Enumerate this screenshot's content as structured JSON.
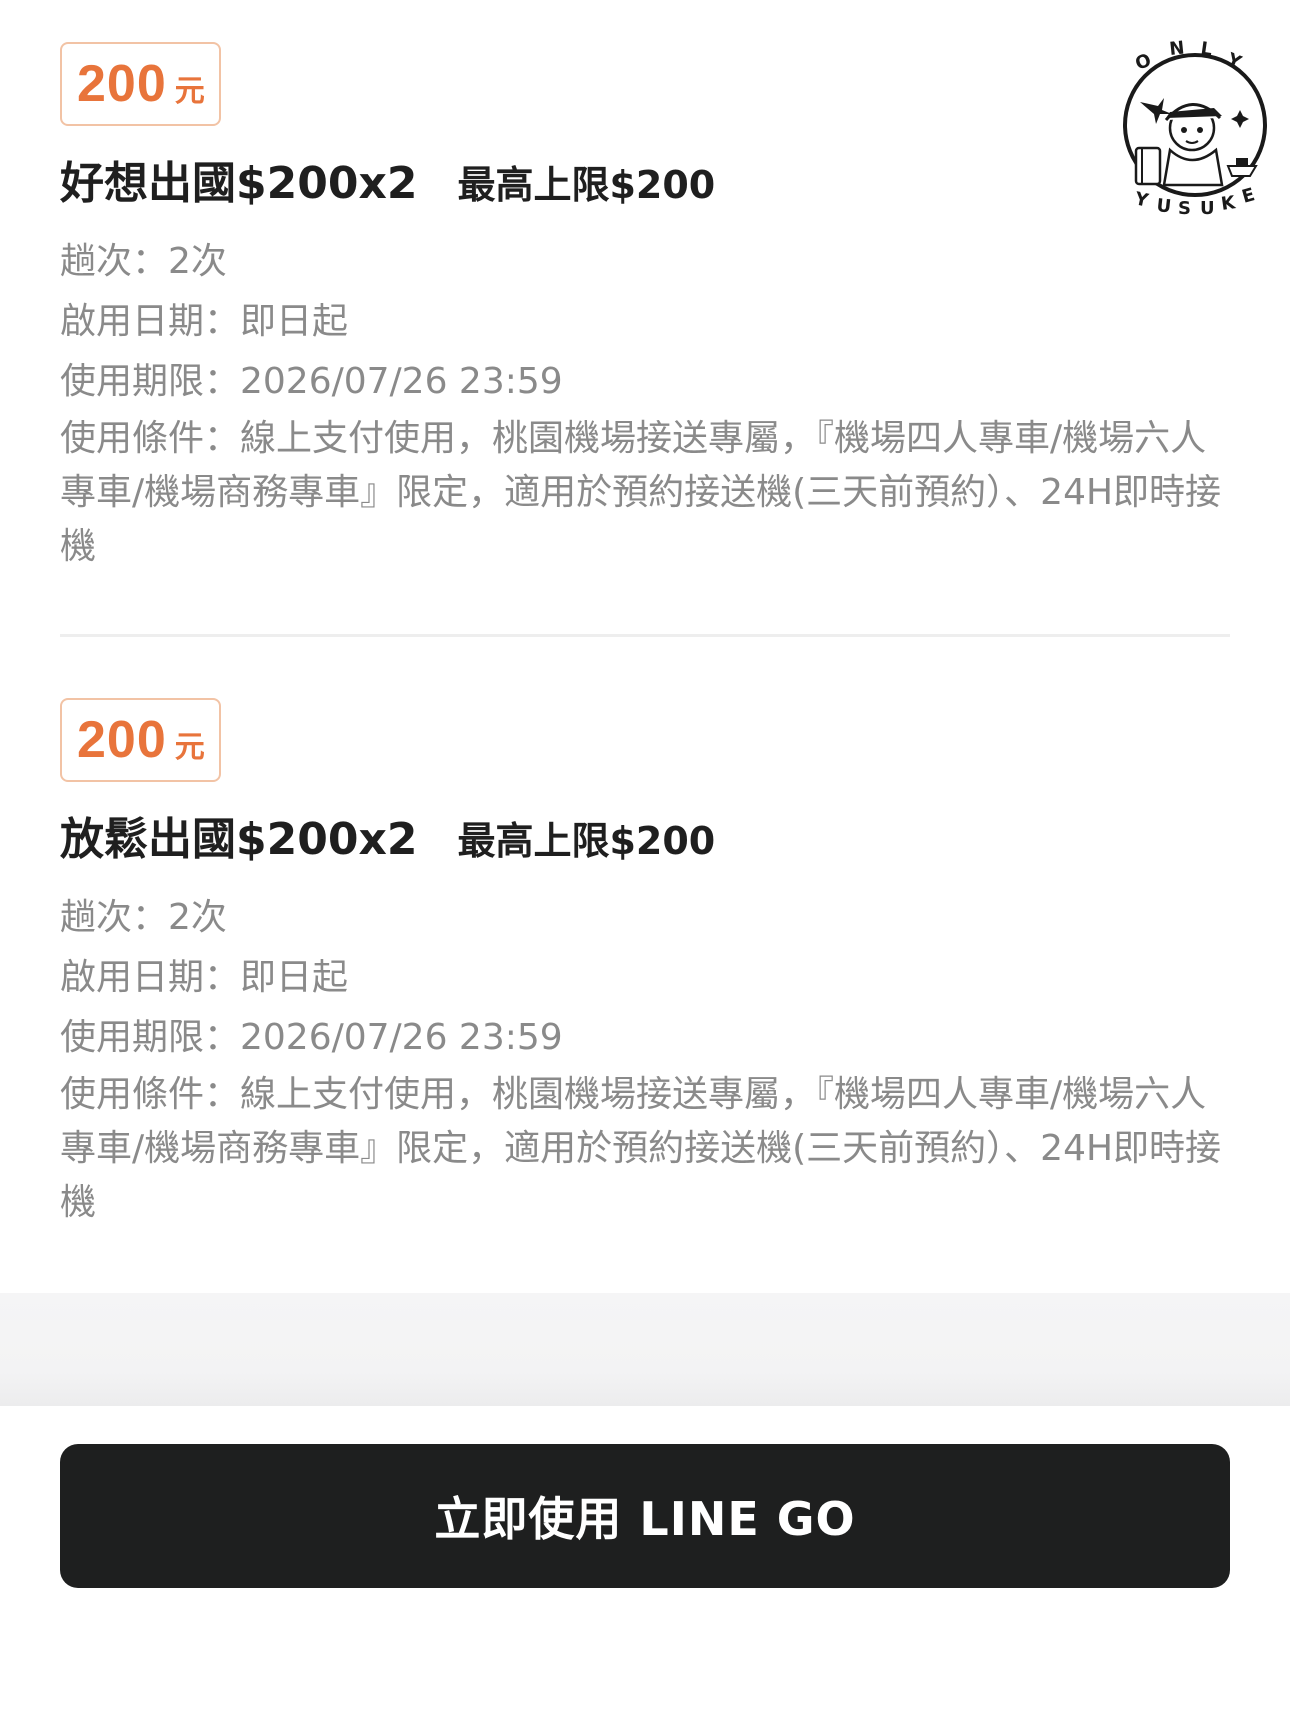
{
  "coupons": [
    {
      "amount": "200",
      "unit": "元",
      "title": "好想出國$200x2",
      "limit": "最高上限$200",
      "trips": "趟次：2次",
      "start_date": "啟用日期：即日起",
      "expiry": "使用期限：2026/07/26 23:59",
      "conditions": "使用條件：線上支付使用，桃園機場接送專屬，『機場四人專車/機場六人專車/機場商務專車』限定，適用於預約接送機(三天前預約）、24H即時接機"
    },
    {
      "amount": "200",
      "unit": "元",
      "title": "放鬆出國$200x2",
      "limit": "最高上限$200",
      "trips": "趟次：2次",
      "start_date": "啟用日期：即日起",
      "expiry": "使用期限：2026/07/26 23:59",
      "conditions": "使用條件：線上支付使用，桃園機場接送專屬，『機場四人專車/機場六人專車/機場商務專車』限定，適用於預約接送機(三天前預約）、24H即時接機"
    }
  ],
  "footer": {
    "cta_label": "立即使用 LINE GO"
  },
  "watermark": {
    "top_text": "ONLY",
    "bottom_text": "YUSUKE"
  },
  "colors": {
    "accent": "#e8743b",
    "badge_border": "#f2c3a5",
    "button": "#1e1f1f",
    "muted_text": "#8a8a8a"
  }
}
